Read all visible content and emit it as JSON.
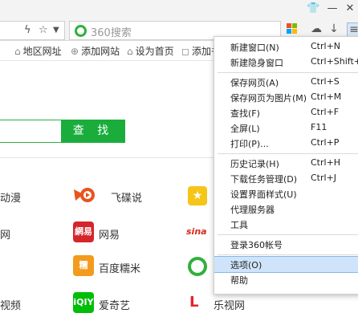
{
  "search": {
    "placeholder": "360搜索",
    "button_label": "查 找"
  },
  "bookmarks": [
    {
      "label": "地区网址",
      "icon": "home-icon"
    },
    {
      "label": "添加网站",
      "icon": "plus-icon"
    },
    {
      "label": "设为首页",
      "icon": "home-icon"
    },
    {
      "label": "添加书",
      "icon": "bookmark-icon"
    }
  ],
  "sites": {
    "col1": [
      "动漫",
      "网",
      "",
      "视频"
    ],
    "col2": [
      "飞碟说",
      "网易",
      "百度糯米",
      "爱奇艺"
    ],
    "col3": [
      "",
      "",
      "",
      "乐视网"
    ]
  },
  "site_logos": {
    "netease": "網易",
    "iqiyi": "iQIY",
    "nuomi": "糯",
    "sina": "sina"
  },
  "menu": [
    {
      "label": "新建窗口(N)",
      "shortcut": "Ctrl+N"
    },
    {
      "label": "新建隐身窗口",
      "shortcut": "Ctrl+Shift+N"
    },
    {
      "label": "保存网页(A)",
      "shortcut": "Ctrl+S"
    },
    {
      "label": "保存网页为图片(M)",
      "shortcut": "Ctrl+M"
    },
    {
      "label": "查找(F)",
      "shortcut": "Ctrl+F"
    },
    {
      "label": "全屏(L)",
      "shortcut": "F11"
    },
    {
      "label": "打印(P)...",
      "shortcut": "Ctrl+P"
    },
    {
      "label": "历史记录(H)",
      "shortcut": "Ctrl+H"
    },
    {
      "label": "下载任务管理(D)",
      "shortcut": "Ctrl+J"
    },
    {
      "label": "设置界面样式(U)",
      "shortcut": ""
    },
    {
      "label": "代理服务器",
      "shortcut": ""
    },
    {
      "label": "工具",
      "shortcut": ""
    },
    {
      "label": "登录360帐号",
      "shortcut": ""
    },
    {
      "label": "选项(O)",
      "shortcut": ""
    },
    {
      "label": "帮助",
      "shortcut": ""
    }
  ],
  "colors": {
    "accent_green": "#1aad3c",
    "menu_highlight": "#cfe4fa"
  }
}
